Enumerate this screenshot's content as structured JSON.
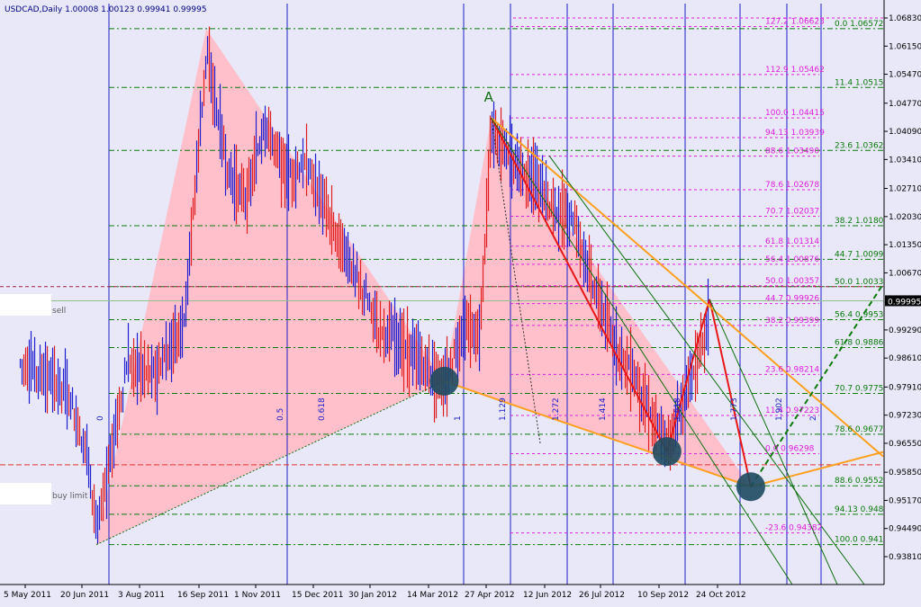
{
  "header": "USDCAD,Daily  1.00008  1.00123  0.99941  0.99995",
  "current_price": "0.99995",
  "chart_data": {
    "type": "candlestick",
    "symbol": "USDCAD",
    "timeframe": "Daily",
    "ohlc": {
      "open": 1.00008,
      "high": 1.00123,
      "low": 0.99941,
      "close": 0.99995
    },
    "ylim": [
      0.9381,
      1.0683
    ],
    "xlim": [
      "2011-05-01",
      "2012-12-30"
    ],
    "y_ticks": [
      "1.06830",
      "1.06150",
      "1.05470",
      "1.04770",
      "1.04090",
      "1.03410",
      "1.02710",
      "1.02030",
      "1.01350",
      "1.00670",
      "0.99995",
      "0.99290",
      "0.98610",
      "0.97910",
      "0.97230",
      "0.96550",
      "0.95850",
      "0.95170",
      "0.94490",
      "0.93810"
    ],
    "x_ticks": [
      {
        "label": "5 May 2011",
        "date": "2011-05-05"
      },
      {
        "label": "20 Jun 2011",
        "date": "2011-06-20"
      },
      {
        "label": "3 Aug 2011",
        "date": "2011-08-03"
      },
      {
        "label": "16 Sep 2011",
        "date": "2011-09-16"
      },
      {
        "label": "1 Nov 2011",
        "date": "2011-11-01"
      },
      {
        "label": "15 Dec 2011",
        "date": "2011-12-15"
      },
      {
        "label": "30 Jan 2012",
        "date": "2012-01-30"
      },
      {
        "label": "14 Mar 2012",
        "date": "2012-03-14"
      },
      {
        "label": "27 Apr 2012",
        "date": "2012-04-27"
      },
      {
        "label": "12 Jun 2012",
        "date": "2012-06-12"
      },
      {
        "label": "26 Jul 2012",
        "date": "2012-07-26"
      },
      {
        "label": "10 Sep 2012",
        "date": "2012-09-10"
      },
      {
        "label": "24 Oct 2012",
        "date": "2012-10-24"
      }
    ],
    "right_fib": [
      {
        "label": "0.0 1.06572",
        "price": 1.06572
      },
      {
        "label": "11.4 1.05150",
        "price": 1.0515
      },
      {
        "label": "23.6 1.03629",
        "price": 1.03629
      },
      {
        "label": "38.2 1.01808",
        "price": 1.01808
      },
      {
        "label": "44.7 1.00997",
        "price": 1.00997
      },
      {
        "label": "50.0 1.00336",
        "price": 1.00336
      },
      {
        "label": "56.4 0.99538",
        "price": 0.99538
      },
      {
        "label": "61.8 0.98865",
        "price": 0.98865
      },
      {
        "label": "70.7 0.97755",
        "price": 0.97755
      },
      {
        "label": "78.6 0.96770",
        "price": 0.9677
      },
      {
        "label": "88.6 0.95523",
        "price": 0.95523
      },
      {
        "label": "94.13 0.94833",
        "price": 0.94833
      },
      {
        "label": "100.0 0.94101",
        "price": 0.94101
      }
    ],
    "mid_fib": [
      {
        "label": "127.2 1.06623",
        "price": 1.06623
      },
      {
        "label": "112.9 1.05462",
        "price": 1.05462
      },
      {
        "label": "100.0 1.04415",
        "price": 1.04415
      },
      {
        "label": "94.13 1.03939",
        "price": 1.03939
      },
      {
        "label": "88.6 1.03490",
        "price": 1.0349
      },
      {
        "label": "78.6 1.02678",
        "price": 1.02678
      },
      {
        "label": "70.7 1.02037",
        "price": 1.02037
      },
      {
        "label": "61.8 1.01314",
        "price": 1.01314
      },
      {
        "label": "56.4 1.00876",
        "price": 1.00876
      },
      {
        "label": "50.0 1.00357",
        "price": 1.00357
      },
      {
        "label": "44.7 0.99926",
        "price": 0.99926
      },
      {
        "label": "38.2 0.99399",
        "price": 0.99399
      },
      {
        "label": "23.6 0.98214",
        "price": 0.98214
      },
      {
        "label": "11.4 0.97223",
        "price": 0.97223
      },
      {
        "label": "0.0 0.96298",
        "price": 0.96298
      },
      {
        "label": "-23.6 0.94382",
        "price": 0.94382
      }
    ],
    "time_zones": [
      "0",
      "0.5",
      "0.618",
      "1",
      "1.129",
      "1.272",
      "1.414",
      "1.618",
      "1.773",
      "1.902",
      "2"
    ],
    "pattern": {
      "label_A": "A",
      "A": {
        "date": "2012-05-01",
        "price": 1.04415
      },
      "swing_high_2011": {
        "date": "2011-09-22",
        "price": 1.0657
      },
      "swing_low_2011": {
        "date": "2011-07-01",
        "price": 0.941
      },
      "B_low": {
        "date": "2012-03-26",
        "price": 0.9805
      },
      "C_low": {
        "date": "2012-09-16",
        "price": 0.9635
      },
      "D_high": {
        "date": "2012-10-18",
        "price": 1.0003
      },
      "E_low": {
        "date": "2012-11-18",
        "price": 0.955
      }
    },
    "orders": {
      "sell": "sell",
      "buy_limit": "buy limit"
    }
  }
}
